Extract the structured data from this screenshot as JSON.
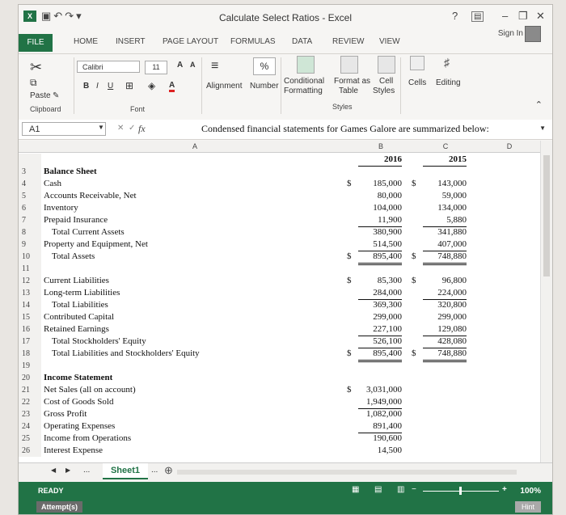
{
  "app": {
    "title": "Calculate Select Ratios - Excel",
    "help": "?",
    "signin": "Sign In"
  },
  "tabs": [
    "FILE",
    "HOME",
    "INSERT",
    "PAGE LAYOUT",
    "FORMULAS",
    "DATA",
    "REVIEW",
    "VIEW"
  ],
  "ribbon": {
    "paste": "Paste",
    "font_name": "Calibri",
    "font_size": "11",
    "grow": "A",
    "shrink": "A",
    "bold": "B",
    "italic": "I",
    "underline": "U",
    "font_color": "A",
    "alignment": "Alignment",
    "number": "Number",
    "percent": "%",
    "conditional_line1": "Conditional",
    "conditional_line2": "Formatting",
    "format_table_line1": "Format as",
    "format_table_line2": "Table",
    "cell_styles_line1": "Cell",
    "cell_styles_line2": "Styles",
    "cells": "Cells",
    "editing": "Editing",
    "groups": {
      "clipboard": "Clipboard",
      "font": "Font",
      "styles": "Styles"
    }
  },
  "formula_bar": {
    "name_box": "A1",
    "fx": "fx",
    "content": "Condensed financial statements for Games Galore are summarized below:"
  },
  "columns": {
    "a": "A",
    "b": "B",
    "c": "C",
    "d": "D"
  },
  "sheet": {
    "year_b": "2016",
    "year_c": "2015",
    "rows": [
      {
        "n": "3",
        "label": "Balance Sheet",
        "bold": true,
        "b": "",
        "c": ""
      },
      {
        "n": "4",
        "label": "Cash",
        "b": "185,000",
        "c": "143,000",
        "bs": "$",
        "cs": "$"
      },
      {
        "n": "5",
        "label": "Accounts Receivable, Net",
        "b": "80,000",
        "c": "59,000"
      },
      {
        "n": "6",
        "label": "Inventory",
        "b": "104,000",
        "c": "134,000"
      },
      {
        "n": "7",
        "label": "Prepaid Insurance",
        "b": "11,900",
        "c": "5,880",
        "ul": true
      },
      {
        "n": "8",
        "label": "Total Current Assets",
        "indent": true,
        "b": "380,900",
        "c": "341,880"
      },
      {
        "n": "9",
        "label": "Property and Equipment, Net",
        "b": "514,500",
        "c": "407,000",
        "ul": true
      },
      {
        "n": "10",
        "label": "Total Assets",
        "indent": true,
        "b": "895,400",
        "c": "748,880",
        "bs": "$",
        "cs": "$",
        "dul": true
      },
      {
        "n": "11",
        "label": "",
        "b": "",
        "c": ""
      },
      {
        "n": "12",
        "label": "Current Liabilities",
        "b": "85,300",
        "c": "96,800",
        "bs": "$",
        "cs": "$"
      },
      {
        "n": "13",
        "label": "Long-term Liabilities",
        "b": "284,000",
        "c": "224,000",
        "ul": true
      },
      {
        "n": "14",
        "label": "Total Liabilities",
        "indent": true,
        "b": "369,300",
        "c": "320,800"
      },
      {
        "n": "15",
        "label": "Contributed Capital",
        "b": "299,000",
        "c": "299,000"
      },
      {
        "n": "16",
        "label": "Retained Earnings",
        "b": "227,100",
        "c": "129,080",
        "ul": true
      },
      {
        "n": "17",
        "label": "Total Stockholders' Equity",
        "indent": true,
        "b": "526,100",
        "c": "428,080",
        "ul": true
      },
      {
        "n": "18",
        "label": "Total Liabilities and Stockholders' Equity",
        "indent": true,
        "b": "895,400",
        "c": "748,880",
        "bs": "$",
        "cs": "$",
        "dul": true
      },
      {
        "n": "19",
        "label": "",
        "b": "",
        "c": ""
      },
      {
        "n": "20",
        "label": "Income Statement",
        "bold": true,
        "b": "",
        "c": ""
      },
      {
        "n": "21",
        "label": "Net Sales (all on account)",
        "b": "3,031,000",
        "c": "",
        "bs": "$"
      },
      {
        "n": "22",
        "label": "Cost of Goods Sold",
        "b": "1,949,000",
        "c": "",
        "ul": true
      },
      {
        "n": "23",
        "label": "Gross Profit",
        "b": "1,082,000",
        "c": ""
      },
      {
        "n": "24",
        "label": "Operating Expenses",
        "b": "891,400",
        "c": "",
        "ul": true
      },
      {
        "n": "25",
        "label": "Income from Operations",
        "b": "190,600",
        "c": ""
      },
      {
        "n": "26",
        "label": "Interest Expense",
        "b": "14,500",
        "c": ""
      }
    ]
  },
  "sheet_tabs": {
    "ellipsis_left": "...",
    "active": "Sheet1",
    "ellipsis_right": "..."
  },
  "status": {
    "ready": "READY",
    "zoom": "100%",
    "attempts": "Attempt(s)",
    "hint": "Hint"
  },
  "colors": {
    "excel_green": "#217346"
  }
}
